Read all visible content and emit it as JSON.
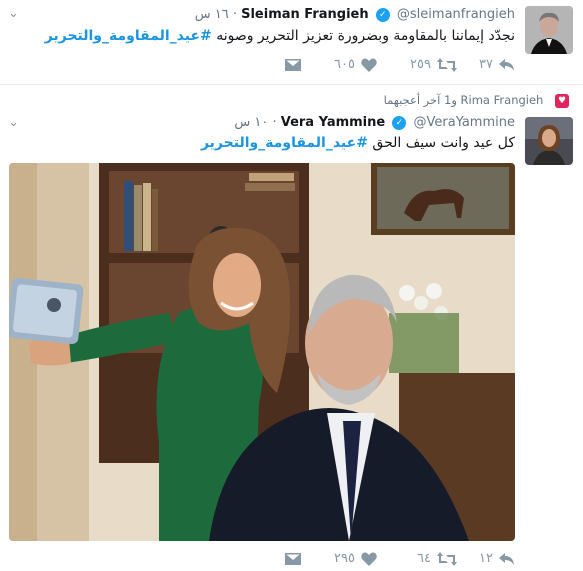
{
  "tweets": [
    {
      "name": "Sleiman Frangieh",
      "handle": "@sleimanfrangieh",
      "time": "١٦ س",
      "text": "نجدّد إيماننا بالمقاومة وبضرورة تعزيز التحرير وصونه",
      "hashtag": "#عيد_المقاومة_والتحرير",
      "replies": "٣٧",
      "retweets": "٢٥٩",
      "likes": "٦٠٥"
    },
    {
      "context": "Rima Frangieh و1 آخر أعجبهما",
      "name": "Vera Yammine",
      "handle": "@VeraYammine",
      "time": "١٠ س",
      "text": "كل عيد وانت سيف الحق",
      "hashtag": "#عيد_المقاومة_والتحرير",
      "replies": "١٢",
      "retweets": "٦٤",
      "likes": "٢٩٥"
    }
  ],
  "icons": {
    "verified": "verified-badge-icon",
    "reply": "reply-icon",
    "retweet": "retweet-icon",
    "like": "heart-icon",
    "dm": "envelope-icon",
    "more": "chevron-down-icon",
    "liked_context": "heart-icon"
  },
  "colors": {
    "link": "#1b95e0",
    "verified": "#1da1f2",
    "muted": "#8899a6",
    "like_badge": "#e0245e"
  }
}
